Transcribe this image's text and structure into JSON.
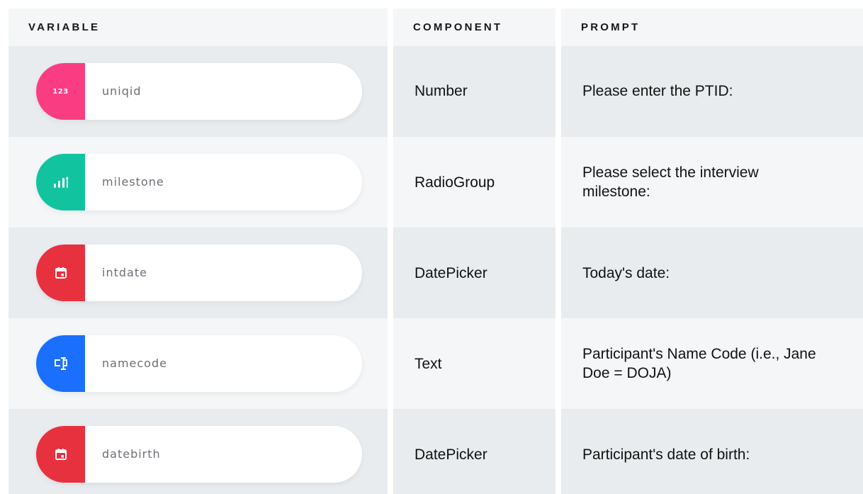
{
  "headers": {
    "variable": "VARIABLE",
    "component": "COMPONENT",
    "prompt": "PROMPT"
  },
  "rows": [
    {
      "variable": "uniqid",
      "icon": "number-123-icon",
      "icon_text": "123",
      "badge_color": "#fa3d82",
      "component": "Number",
      "prompt": "Please enter the PTID:"
    },
    {
      "variable": "milestone",
      "icon": "signal-bars-icon",
      "icon_text": "",
      "badge_color": "#12c3a0",
      "component": "RadioGroup",
      "prompt": "Please select the interview milestone:"
    },
    {
      "variable": "intdate",
      "icon": "calendar-icon",
      "icon_text": "",
      "badge_color": "#e8313f",
      "component": "DatePicker",
      "prompt": "Today's date:"
    },
    {
      "variable": "namecode",
      "icon": "text-cursor-icon",
      "icon_text": "",
      "badge_color": "#1a6fff",
      "component": "Text",
      "prompt": "Participant's Name Code (i.e., Jane Doe = DOJA)"
    },
    {
      "variable": "datebirth",
      "icon": "calendar-icon",
      "icon_text": "",
      "badge_color": "#e8313f",
      "component": "DatePicker",
      "prompt": "Participant's date of birth:"
    }
  ]
}
